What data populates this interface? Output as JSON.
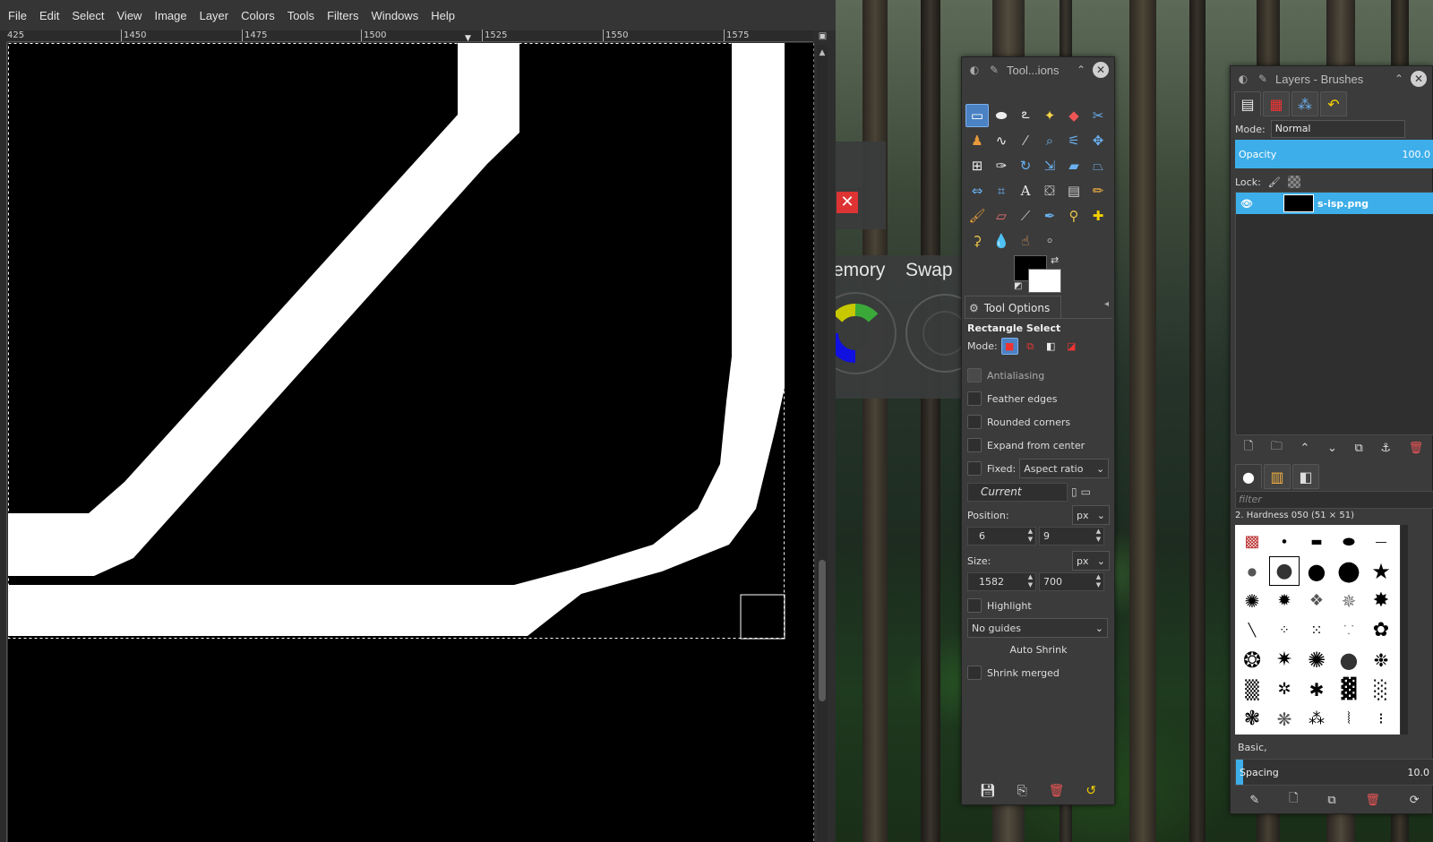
{
  "menubar": {
    "items": [
      "File",
      "Edit",
      "Select",
      "View",
      "Image",
      "Layer",
      "Colors",
      "Tools",
      "Filters",
      "Windows",
      "Help"
    ]
  },
  "ruler": {
    "labels": [
      "425",
      "1450",
      "1475",
      "1500",
      "1525",
      "1550",
      "1575"
    ]
  },
  "background_widget": {
    "memory_label": "emory",
    "swap_label": "Swap"
  },
  "toolbox": {
    "title": "Tool...ions",
    "tab_label": "Tool Options",
    "tool_name": "Rectangle Select",
    "mode_label": "Mode:",
    "options": {
      "antialiasing": "Antialiasing",
      "feather_edges": "Feather edges",
      "rounded_corners": "Rounded corners",
      "expand_from_center": "Expand from center",
      "fixed": "Fixed:",
      "fixed_value": "Aspect ratio",
      "current": "Current",
      "position_label": "Position:",
      "position_unit": "px",
      "position_x": "6",
      "position_y": "9",
      "size_label": "Size:",
      "size_unit": "px",
      "size_w": "1582",
      "size_h": "700",
      "highlight": "Highlight",
      "guides": "No guides",
      "auto_shrink": "Auto Shrink",
      "shrink_merged": "Shrink merged"
    },
    "colors": {
      "foreground": "#000000",
      "background": "#ffffff"
    }
  },
  "layers_dock": {
    "title": "Layers - Brushes",
    "mode_label": "Mode:",
    "mode_value": "Normal",
    "opacity_label": "Opacity",
    "opacity_value": "100.0",
    "lock_label": "Lock:",
    "layer_name": "s-isp.png",
    "brush_filter": "filter",
    "brush_name": "2. Hardness 050 (51 × 51)",
    "brush_preset": "Basic,",
    "spacing_label": "Spacing",
    "spacing_value": "10.0"
  },
  "colors": {
    "accent": "#3daee9",
    "tool_active": "#4a82c4",
    "panel_bg": "#3b3b3b"
  }
}
